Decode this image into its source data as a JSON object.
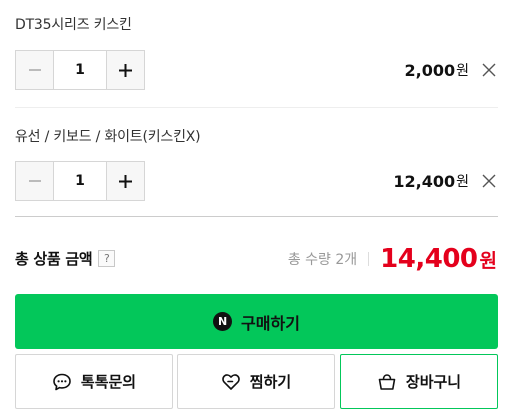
{
  "options": [
    {
      "name": "DT35시리즈 키스킨",
      "quantity": "1",
      "price": "2,000",
      "unit": "원"
    },
    {
      "name": "유선 / 키보드 / 화이트(키스킨X)",
      "quantity": "1",
      "price": "12,400",
      "unit": "원"
    }
  ],
  "total": {
    "label": "총 상품 금액",
    "help": "?",
    "quantity_text": "총 수량 2개",
    "amount": "14,400",
    "unit": "원"
  },
  "buttons": {
    "buy": "구매하기",
    "buy_badge": "N",
    "talk": "톡톡문의",
    "wish": "찜하기",
    "cart": "장바구니"
  },
  "icons": {
    "minus": "minus-icon",
    "plus": "plus-icon",
    "remove": "close-icon",
    "talk": "chat-bubble-icon",
    "wish": "heart-icon",
    "cart": "shopping-bag-icon"
  },
  "colors": {
    "brand_green": "#03c75a",
    "price_red": "#e4001c"
  }
}
